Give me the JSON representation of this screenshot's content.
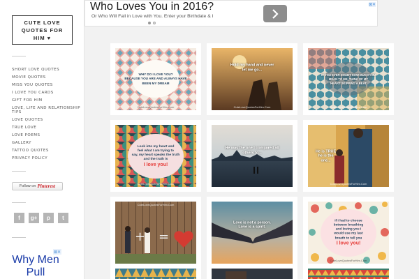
{
  "site": {
    "logo_text": "CUTE LOVE QUOTES FOR HIM ♥"
  },
  "sidebar": {
    "nav_items": [
      "SHORT LOVE QUOTES",
      "MOVIE QUOTES",
      "MISS YOU QUOTES",
      "I LOVE YOU CARDS",
      "GIFT FOR HIM",
      "LOVE, LIFE AND RELATIONSHIP TIPS",
      "LOVE QUOTES",
      "TRUE LOVE",
      "LOVE POEMS",
      "GALLERY",
      "TATTOO QUOTES",
      "PRIVACY POLICY"
    ],
    "pinterest_follow": "Follow on",
    "pinterest_brand": "Pinterest",
    "social_icons": [
      "f",
      "g+",
      "p",
      "t"
    ],
    "ad_title": "Why Men Pull",
    "ad_close": "⊠✕"
  },
  "top_ad": {
    "title": "Who Loves You in 2016?",
    "subtitle": "Or Who Will Fall in Love with You. Enter your Birthdate & I",
    "arrow": "›",
    "close": "⊠✕"
  },
  "cards": [
    {
      "caption": "WHY DO I LOVE YOU?\nBECAUSE YOU ARE AND ALWAYS HAVE\nBEEN MY DREAM",
      "accent": "",
      "watermark": "CuteLoveQuotesForHim.Com"
    },
    {
      "caption": "Hold my hand and never\nlet me go...",
      "accent": "",
      "watermark": "CuteLoveQuotesForHim.Com"
    },
    {
      "caption": "IF YOU EVER DOUBT HOW MUCH YOU\nMEAN TO ME, THINK OF MY\nHEART SKIPPING A BEAT",
      "accent": "",
      "watermark": "CuteLoveQuotesForHim.Com"
    },
    {
      "caption": "Look into my heart and\nfeel what I am trying to\nsay, my heart speaks the truth\nand the truth is",
      "accent": "I love you!",
      "watermark": "CuteLoveQuotesForHim.Com"
    },
    {
      "caption": "He was the one I compared all\nothers to...",
      "accent": "",
      "watermark": ""
    },
    {
      "caption": "He is TRUE\nhe is the\none...",
      "accent": "",
      "watermark": "CuteLoveQuotesForHim.Com"
    },
    {
      "caption": "",
      "accent": "",
      "watermark": "CuteLoveQuotesForHim.Com"
    },
    {
      "caption": "Love is not a person.\nLove is a spirit.",
      "accent": "",
      "watermark": ""
    },
    {
      "caption": "If I had to choose\nbetween breathing\nand loving you I\nwould use my last\nbreath to tell you",
      "accent": "I love you!",
      "watermark": "CuteLoveQuotesForHim.Com"
    }
  ],
  "colors": {
    "accent_red": "#e53935",
    "pinterest_red": "#cb2027",
    "ad_blue": "#1a3ba8"
  }
}
